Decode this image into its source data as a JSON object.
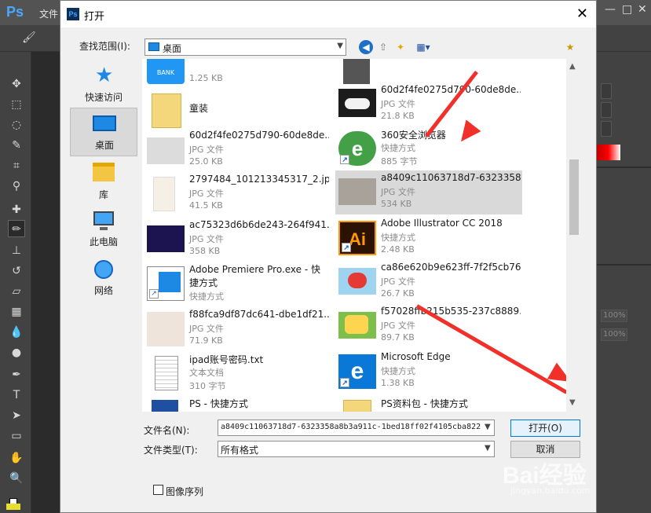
{
  "ps_menu": {
    "logo": "Ps",
    "first_menu": "文件",
    "minimize": "—",
    "maximize": "□",
    "close": "✕"
  },
  "dialog": {
    "title_icon": "Ps",
    "title": "打开",
    "close_glyph": "✕",
    "look_in_label": "查找范围(I):",
    "look_in_value": "桌面",
    "places": [
      {
        "label": "快速访问",
        "icon": "star-icon"
      },
      {
        "label": "桌面",
        "icon": "desktop-icon",
        "selected": true
      },
      {
        "label": "库",
        "icon": "library-icon"
      },
      {
        "label": "此电脑",
        "icon": "computer-icon"
      },
      {
        "label": "网络",
        "icon": "network-icon"
      }
    ],
    "files": [
      {
        "name": "...",
        "type": "",
        "size": "1.25 KB",
        "icon": "bank-app-icon"
      },
      {
        "name": "童装",
        "type": "",
        "size": "",
        "icon": "folder-icon"
      },
      {
        "name": "60d2f4fe0275d790-60de8de...",
        "type": "JPG 文件",
        "size": "25.0 KB",
        "icon": "image-icon"
      },
      {
        "name": "2797484_101213345317_2.jpg",
        "type": "JPG 文件",
        "size": "41.5 KB",
        "icon": "image-icon"
      },
      {
        "name": "ac75323d6b6de243-264f941...",
        "type": "JPG 文件",
        "size": "358 KB",
        "icon": "image-icon"
      },
      {
        "name": "Adobe Premiere Pro.exe - 快捷方式",
        "type": "快捷方式",
        "size": "",
        "icon": "shortcut-icon"
      },
      {
        "name": "f88fca9df87dc641-dbe1df21...",
        "type": "JPG 文件",
        "size": "71.9 KB",
        "icon": "image-icon"
      },
      {
        "name": "ipad账号密码.txt",
        "type": "文本文档",
        "size": "310 字节",
        "icon": "text-file-icon"
      },
      {
        "name": "PS - 快捷方式",
        "type": "",
        "size": "",
        "icon": "shortcut-icon"
      },
      {
        "name": "...",
        "type": "",
        "size": "",
        "icon": "app-icon"
      },
      {
        "name": "60d2f4fe0275d790-60de8de...",
        "type": "JPG 文件",
        "size": "21.8 KB",
        "icon": "image-icon"
      },
      {
        "name": "360安全浏览器",
        "type": "快捷方式",
        "size": "885 字节",
        "icon": "browser-360-icon"
      },
      {
        "name": "a8409c11063718d7-6323358...",
        "type": "JPG 文件",
        "size": "534 KB",
        "icon": "image-icon",
        "selected": true
      },
      {
        "name": "Adobe Illustrator CC 2018",
        "type": "快捷方式",
        "size": "2.48 KB",
        "icon": "illustrator-icon"
      },
      {
        "name": "ca86e620b9e623ff-7f2f5cb76...",
        "type": "JPG 文件",
        "size": "26.7 KB",
        "icon": "image-icon"
      },
      {
        "name": "f57028ffb215b535-237c8889...",
        "type": "JPG 文件",
        "size": "89.7 KB",
        "icon": "image-icon"
      },
      {
        "name": "Microsoft Edge",
        "type": "快捷方式",
        "size": "1.38 KB",
        "icon": "edge-icon"
      },
      {
        "name": "PS资料包 - 快捷方式",
        "type": "",
        "size": "",
        "icon": "folder-shortcut-icon"
      }
    ],
    "filename_label": "文件名(N):",
    "filename_value": "a8409c11063718d7-6323358a8b3a911c-1bed18ff02f4105cba822",
    "filetype_label": "文件类型(T):",
    "filetype_value": "所有格式",
    "open_button": "打开(O)",
    "cancel_button": "取消",
    "image_sequence_label": "图像序列"
  },
  "watermark": {
    "brand": "Bai经验",
    "url": "jingyan.baidu.com"
  },
  "ps_panels": {
    "opacity_1": "100%",
    "opacity_2": "100%"
  }
}
